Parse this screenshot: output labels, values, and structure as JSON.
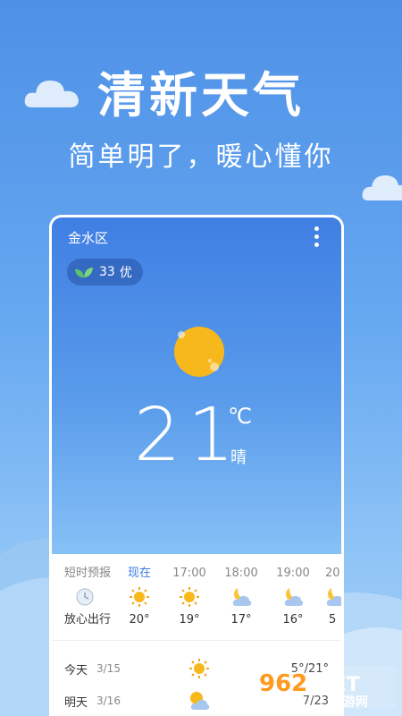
{
  "hero": {
    "title": "清新天气",
    "subtitle": "简单明了，暖心懂你"
  },
  "card": {
    "location": "金水区",
    "aqi": {
      "value": "33",
      "level": "优"
    },
    "current": {
      "temp": "21",
      "unit": "℃",
      "condition": "晴"
    },
    "hourly": {
      "label_top": "短时预报",
      "label_bottom": "放心出行",
      "items": [
        {
          "time": "现在",
          "icon": "sun-icon",
          "temp": "20°"
        },
        {
          "time": "17:00",
          "icon": "sun-icon",
          "temp": "19°"
        },
        {
          "time": "18:00",
          "icon": "moon-cloud-icon",
          "temp": "17°"
        },
        {
          "time": "19:00",
          "icon": "moon-cloud-icon",
          "temp": "16°"
        },
        {
          "time": "20",
          "icon": "moon-cloud-icon",
          "temp": "5"
        }
      ]
    },
    "daily": [
      {
        "day": "今天",
        "date": "3/15",
        "icon": "sun-icon",
        "temp": "5°/21°"
      },
      {
        "day": "明天",
        "date": "3/16",
        "icon": "partly-cloudy-icon",
        "temp": "7/23"
      }
    ]
  },
  "watermark": {
    "text1": "962",
    "text2": ".NET",
    "text3": "乐游网"
  },
  "colors": {
    "sun": "#f7b81c",
    "accent": "#3a7de0",
    "sky_top": "#4e90e6"
  }
}
